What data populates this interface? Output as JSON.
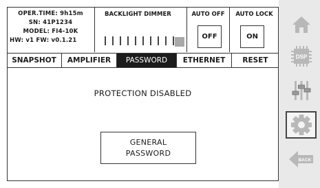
{
  "info": {
    "oper_time": "OPER.TIME: 9h15m",
    "sn": "SN: 41P1234",
    "model": "MODEL: FI4-10K",
    "versions": "HW: v1  FW: v0.1.21"
  },
  "dimmer": {
    "title": "BACKLIGHT DIMMER",
    "level": 1.0
  },
  "auto_off": {
    "title": "AUTO OFF",
    "value": "OFF"
  },
  "auto_lock": {
    "title": "AUTO LOCK",
    "value": "ON"
  },
  "tabs": [
    {
      "label": "SNAPSHOT"
    },
    {
      "label": "AMPLIFIER"
    },
    {
      "label": "PASSWORD"
    },
    {
      "label": "ETHERNET"
    },
    {
      "label": "RESET"
    }
  ],
  "active_tab": "PASSWORD",
  "status": "PROTECTION DISABLED",
  "password_button": "GENERAL\nPASSWORD",
  "sidebar": {
    "items": [
      {
        "icon": "home-icon"
      },
      {
        "icon": "dsp-icon",
        "label": "DSP"
      },
      {
        "icon": "sliders-icon"
      },
      {
        "icon": "gear-icon",
        "selected": true
      },
      {
        "icon": "back-icon",
        "label": "BACK"
      }
    ]
  },
  "colors": {
    "sidebar_bg": "#e9e9e9",
    "icon_gray": "#b8b8b8",
    "active_tab_bg": "#1c1c1c"
  }
}
